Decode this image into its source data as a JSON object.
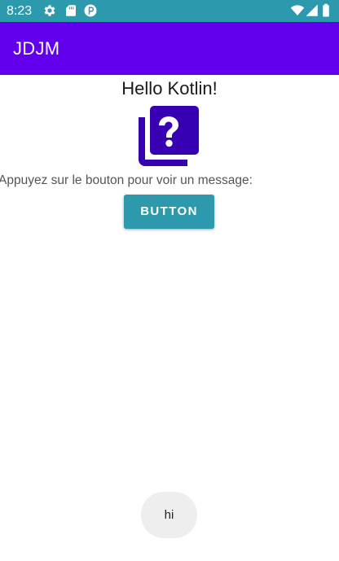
{
  "status_bar": {
    "time": "8:23",
    "background": "#2c99ad",
    "left_icons": [
      "gear-icon",
      "sd-card-icon",
      "sync-icon"
    ],
    "right_icons": [
      "wifi-icon",
      "cell-signal-icon",
      "battery-icon"
    ]
  },
  "app_bar": {
    "title": "JDJM",
    "background": "#6200ee"
  },
  "content": {
    "heading": "Hello Kotlin!",
    "image_icon": "question-library-icon",
    "image_color": "#3700b3",
    "instruction": "Appuyez sur le bouton pour voir un message:",
    "button_label": "BUTTON",
    "button_color": "#2c99ad"
  },
  "toast": {
    "message": "hi"
  }
}
